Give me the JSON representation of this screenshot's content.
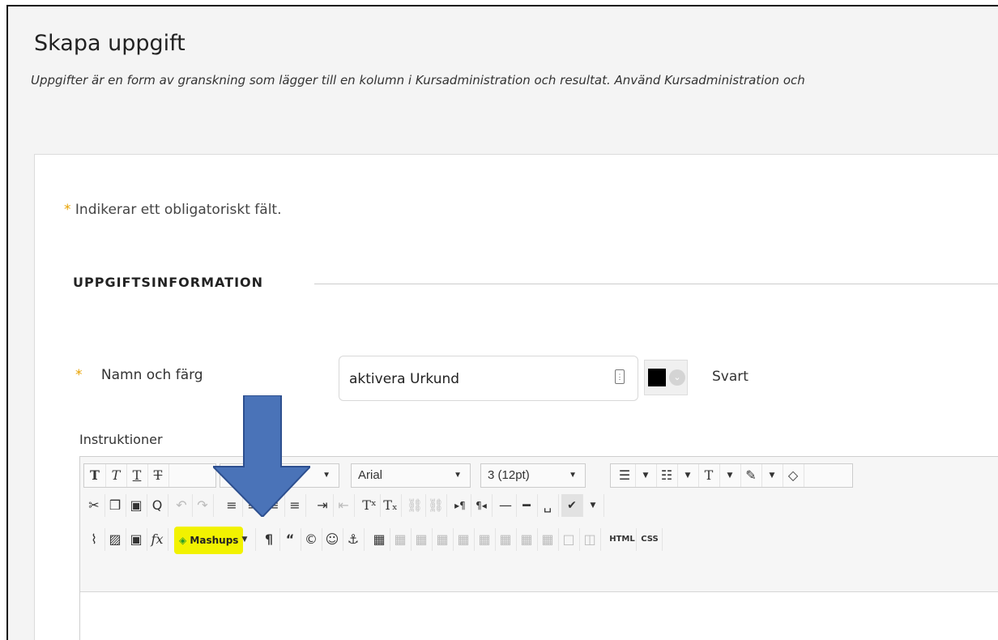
{
  "page": {
    "title": "Skapa uppgift",
    "description": "Uppgifter är en form av granskning som lägger till en kolumn i Kursadministration och resultat. Använd Kursadministration och"
  },
  "form": {
    "required_star": "*",
    "required_note": "Indikerar ett obligatoriskt fält.",
    "section_title": "UPPGIFTSINFORMATION",
    "name_label": "Namn och färg",
    "name_value": "aktivera Urkund",
    "color_name": "Svart",
    "color_value": "#000000",
    "instructions_label": "Instruktioner"
  },
  "editor": {
    "row1": {
      "format_buttons": [
        "T",
        "T",
        "T",
        "T"
      ],
      "font_family": "Arial",
      "font_size": "3 (12pt)"
    },
    "row3": {
      "mashups_label": "Mashups",
      "html_label": "HTML",
      "css_label": "CSS"
    }
  },
  "colors": {
    "accent_star": "#e8a200",
    "highlight": "#f2f200",
    "arrow": "#4a73b8"
  }
}
